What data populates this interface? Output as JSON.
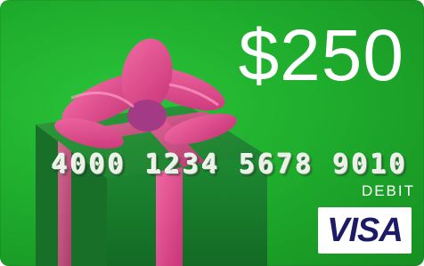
{
  "card": {
    "amount": "$250",
    "card_number": "4000 1234 5678 9010",
    "card_type": "DEBIT",
    "network_logo_text": "VISA"
  },
  "colors": {
    "card_green": "#1fae2d",
    "box_green": "#1a7d2f",
    "ribbon_pink": "#e0468c",
    "visa_blue": "#1d1a66"
  },
  "images": {
    "gift_box": "gift-box-illustration"
  }
}
